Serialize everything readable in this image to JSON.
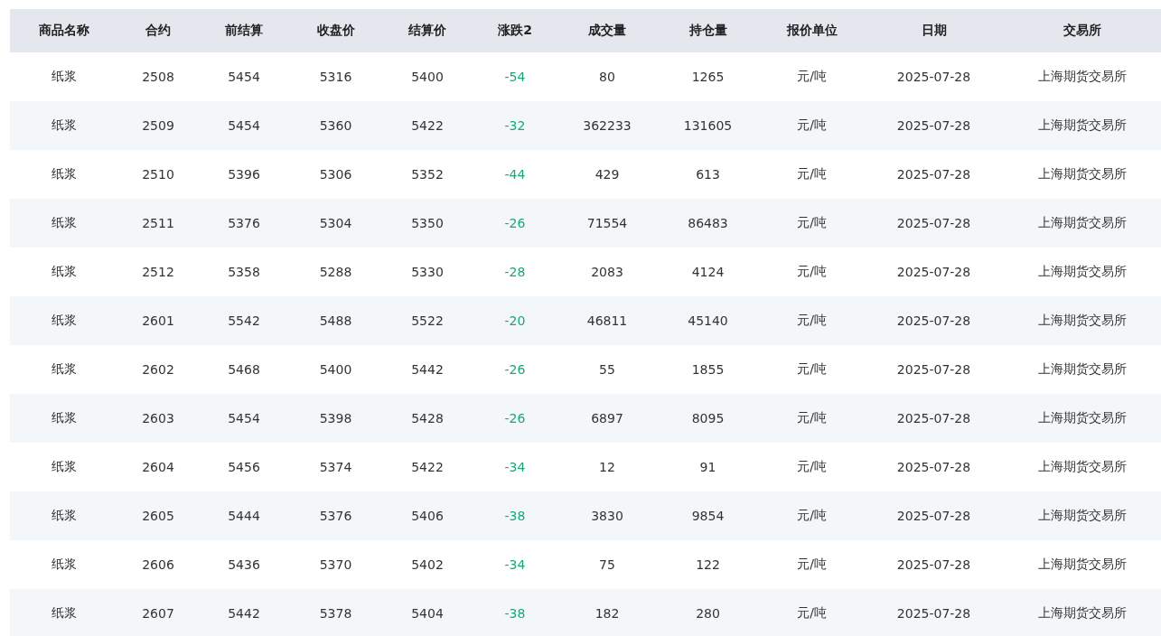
{
  "table": {
    "columns": [
      {
        "label": "商品名称",
        "kind": "text"
      },
      {
        "label": "合约",
        "kind": "text"
      },
      {
        "label": "前结算",
        "kind": "text"
      },
      {
        "label": "收盘价",
        "kind": "text"
      },
      {
        "label": "结算价",
        "kind": "text"
      },
      {
        "label": "涨跌2",
        "kind": "change"
      },
      {
        "label": "成交量",
        "kind": "text"
      },
      {
        "label": "持仓量",
        "kind": "text"
      },
      {
        "label": "报价单位",
        "kind": "text"
      },
      {
        "label": "日期",
        "kind": "text"
      },
      {
        "label": "交易所",
        "kind": "text"
      }
    ],
    "rows": [
      [
        "纸浆",
        "2508",
        "5454",
        "5316",
        "5400",
        "-54",
        "80",
        "1265",
        "元/吨",
        "2025-07-28",
        "上海期货交易所"
      ],
      [
        "纸浆",
        "2509",
        "5454",
        "5360",
        "5422",
        "-32",
        "362233",
        "131605",
        "元/吨",
        "2025-07-28",
        "上海期货交易所"
      ],
      [
        "纸浆",
        "2510",
        "5396",
        "5306",
        "5352",
        "-44",
        "429",
        "613",
        "元/吨",
        "2025-07-28",
        "上海期货交易所"
      ],
      [
        "纸浆",
        "2511",
        "5376",
        "5304",
        "5350",
        "-26",
        "71554",
        "86483",
        "元/吨",
        "2025-07-28",
        "上海期货交易所"
      ],
      [
        "纸浆",
        "2512",
        "5358",
        "5288",
        "5330",
        "-28",
        "2083",
        "4124",
        "元/吨",
        "2025-07-28",
        "上海期货交易所"
      ],
      [
        "纸浆",
        "2601",
        "5542",
        "5488",
        "5522",
        "-20",
        "46811",
        "45140",
        "元/吨",
        "2025-07-28",
        "上海期货交易所"
      ],
      [
        "纸浆",
        "2602",
        "5468",
        "5400",
        "5442",
        "-26",
        "55",
        "1855",
        "元/吨",
        "2025-07-28",
        "上海期货交易所"
      ],
      [
        "纸浆",
        "2603",
        "5454",
        "5398",
        "5428",
        "-26",
        "6897",
        "8095",
        "元/吨",
        "2025-07-28",
        "上海期货交易所"
      ],
      [
        "纸浆",
        "2604",
        "5456",
        "5374",
        "5422",
        "-34",
        "12",
        "91",
        "元/吨",
        "2025-07-28",
        "上海期货交易所"
      ],
      [
        "纸浆",
        "2605",
        "5444",
        "5376",
        "5406",
        "-38",
        "3830",
        "9854",
        "元/吨",
        "2025-07-28",
        "上海期货交易所"
      ],
      [
        "纸浆",
        "2606",
        "5436",
        "5370",
        "5402",
        "-34",
        "75",
        "122",
        "元/吨",
        "2025-07-28",
        "上海期货交易所"
      ],
      [
        "纸浆",
        "2607",
        "5442",
        "5378",
        "5404",
        "-38",
        "182",
        "280",
        "元/吨",
        "2025-07-28",
        "上海期货交易所"
      ]
    ]
  }
}
